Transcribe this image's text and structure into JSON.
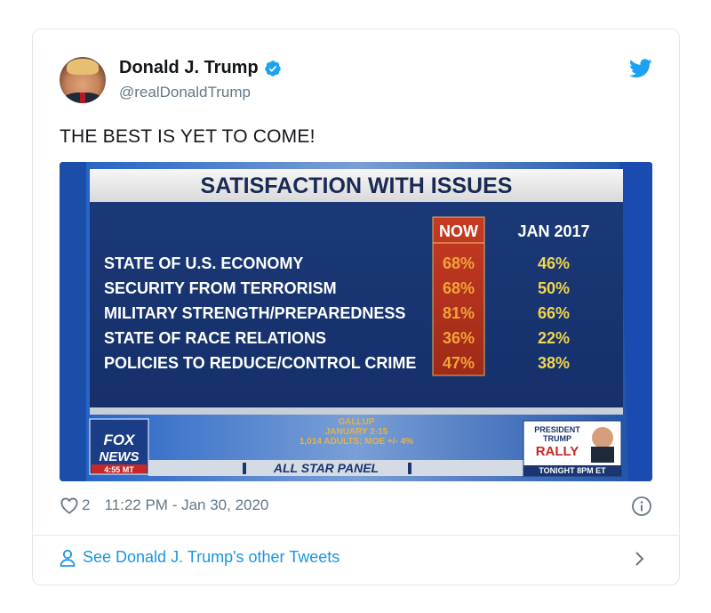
{
  "tweet": {
    "author_name": "Donald J. Trump",
    "handle": "@realDonaldTrump",
    "text": "THE BEST IS YET TO COME!",
    "likes": "2",
    "timestamp": "11:22 PM - Jan 30, 2020",
    "more_link": "See Donald J. Trump's other Tweets"
  },
  "colors": {
    "twitter_blue": "#1da1f2",
    "link_blue": "#1b95e0",
    "muted": "#657786",
    "graphic_navy": "#1a3570",
    "now_column_red": "#b8311e",
    "now_value_orange": "#f2a43a",
    "jan_value_yellow": "#f2d64b"
  },
  "icons": [
    "verified-badge-icon",
    "twitter-bird-icon",
    "heart-icon",
    "info-icon",
    "person-icon",
    "chevron-right-icon"
  ],
  "graphic": {
    "title": "SATISFACTION WITH ISSUES",
    "col_now": "NOW",
    "col_jan": "JAN 2017",
    "rows": [
      {
        "label": "STATE OF U.S. ECONOMY",
        "now": "68%",
        "jan": "46%"
      },
      {
        "label": "SECURITY FROM TERRORISM",
        "now": "68%",
        "jan": "50%"
      },
      {
        "label": "MILITARY STRENGTH/PREPAREDNESS",
        "now": "81%",
        "jan": "66%"
      },
      {
        "label": "STATE OF RACE RELATIONS",
        "now": "36%",
        "jan": "22%"
      },
      {
        "label": "POLICIES TO REDUCE/CONTROL CRIME",
        "now": "47%",
        "jan": "38%"
      }
    ],
    "source_1": "GALLUP",
    "source_2": "JANUARY 2-15",
    "source_3": "1,014 ADULTS; MOE +/- 4%",
    "logo_1": "FOX",
    "logo_2": "NEWS",
    "clock": "4:55 MT",
    "panel": "ALL STAR PANEL",
    "promo_1": "PRESIDENT",
    "promo_2": "TRUMP",
    "promo_3": "RALLY",
    "promo_4": "TONIGHT 8PM ET"
  }
}
